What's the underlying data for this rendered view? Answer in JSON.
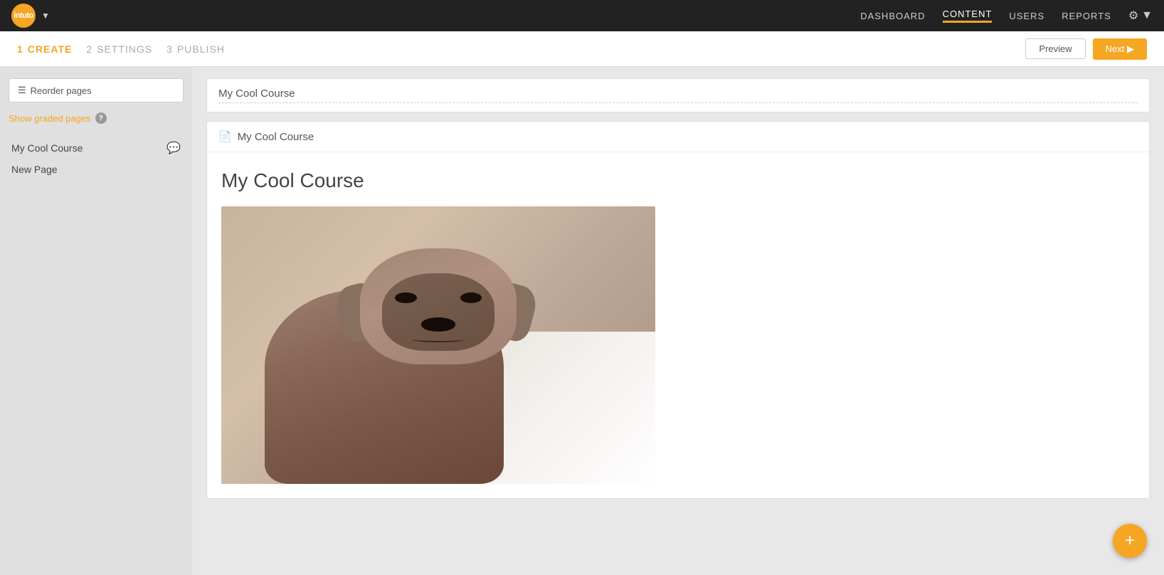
{
  "app": {
    "logo_text": "intuto",
    "logo_bg": "#f5a623"
  },
  "nav": {
    "links": [
      {
        "label": "DASHBOARD",
        "active": false
      },
      {
        "label": "CONTENT",
        "active": true
      },
      {
        "label": "USERS",
        "active": false
      },
      {
        "label": "REPORTS",
        "active": false
      }
    ],
    "settings_icon": "⚙"
  },
  "steps": {
    "step1_num": "1",
    "step1_label": "CREATE",
    "step2_num": "2",
    "step2_label": "SETTINGS",
    "step3_num": "3",
    "step3_label": "PUBLISH",
    "preview_label": "Preview",
    "next_label": "Next ▶"
  },
  "sidebar": {
    "reorder_label": "Reorder pages",
    "show_graded_label": "Show graded pages",
    "pages": [
      {
        "title": "My Cool Course",
        "has_chat": true
      },
      {
        "title": "New Page",
        "has_chat": false
      }
    ]
  },
  "content": {
    "breadcrumb_title": "My Cool Course",
    "page_title": "My Cool Course",
    "course_heading": "My Cool Course"
  },
  "fab": {
    "icon": "+"
  }
}
